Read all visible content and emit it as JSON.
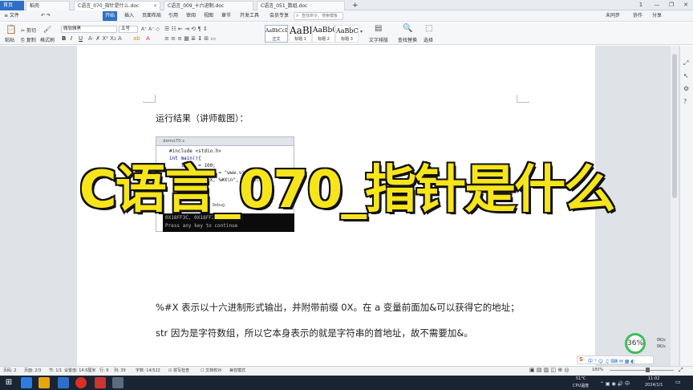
{
  "titlebar": {
    "home_tab": "首页",
    "tabs": [
      {
        "label": "稻壳",
        "active": false
      },
      {
        "label": "C语言_070_指针是什么.doc",
        "active": true
      },
      {
        "label": "C语言_009_十六进制.doc",
        "active": false
      },
      {
        "label": "C语言_051_数组.doc",
        "active": false
      }
    ],
    "new_tab": "+",
    "window_controls": [
      "1",
      "—",
      "❐",
      "✕"
    ]
  },
  "menubar": {
    "file": "≡ 文件",
    "items": [
      "开始",
      "插入",
      "页面布局",
      "引用",
      "审阅",
      "视图",
      "章节",
      "开发工具",
      "会员专享"
    ],
    "active": "开始",
    "search_placeholder": "查找命令、搜索模板",
    "right": [
      "未同步",
      "协作",
      "分享"
    ]
  },
  "ribbon": {
    "paste": "粘贴",
    "cut": "剪切",
    "copy": "复制",
    "format_painter": "格式刷",
    "font_name": "微软雅黑",
    "font_size": "五号",
    "bold": "B",
    "italic": "I",
    "underline": "U",
    "styles": [
      {
        "preview": "AaBbCcDd",
        "name": "正文"
      },
      {
        "preview": "AaBl",
        "name": "标题 1"
      },
      {
        "preview": "AaBbC",
        "name": "标题 2"
      },
      {
        "preview": "AaBbC",
        "name": "标题 3"
      }
    ],
    "text_layout": "文字排版",
    "find_replace": "查找替换",
    "select": "选择"
  },
  "document": {
    "heading": "运行结果（讲师截图）：",
    "screenshot": {
      "window_title": "demo70.c",
      "code_lines": [
        "#include <stdio.h>",
        "int main(){",
        "    int a = 100;",
        "    char str[20] = \"www.vipkes.cn\";",
        "    printf(\"%#X, %#X\\n\", &a, str);"
      ],
      "console_tab": "Debug",
      "console_lines": [
        "0X18FF3C, 0X18FF28",
        "Press any key to continue"
      ]
    },
    "overlay_title": "C语言_070_指针是什么",
    "para1": "%#X 表示以十六进制形式输出，并附带前缀 0X。在 a 变量前面加&可以获得它的地址；",
    "para2": "str 因为是字符数组，所以它本身表示的就是字符串的首地址，故不需要加&。"
  },
  "perf_widget": {
    "percent": "36%",
    "up": "0K/s",
    "down": "0K/s"
  },
  "statusbar": {
    "page": "页码: 2",
    "pages": "页面: 2/3",
    "section": "节: 1/1",
    "setting": "设置值: 14.6厘米",
    "row": "行: 9",
    "col": "列: 39",
    "words": "字数: 14/522",
    "spell": "拼写检查",
    "doc_check": "文档校对",
    "compat": "兼容模式",
    "zoom": "180%"
  },
  "taskbar": {
    "temp": "51°C",
    "cpu": "CPU温度",
    "time": "11:02",
    "date": "2024/1/1"
  }
}
